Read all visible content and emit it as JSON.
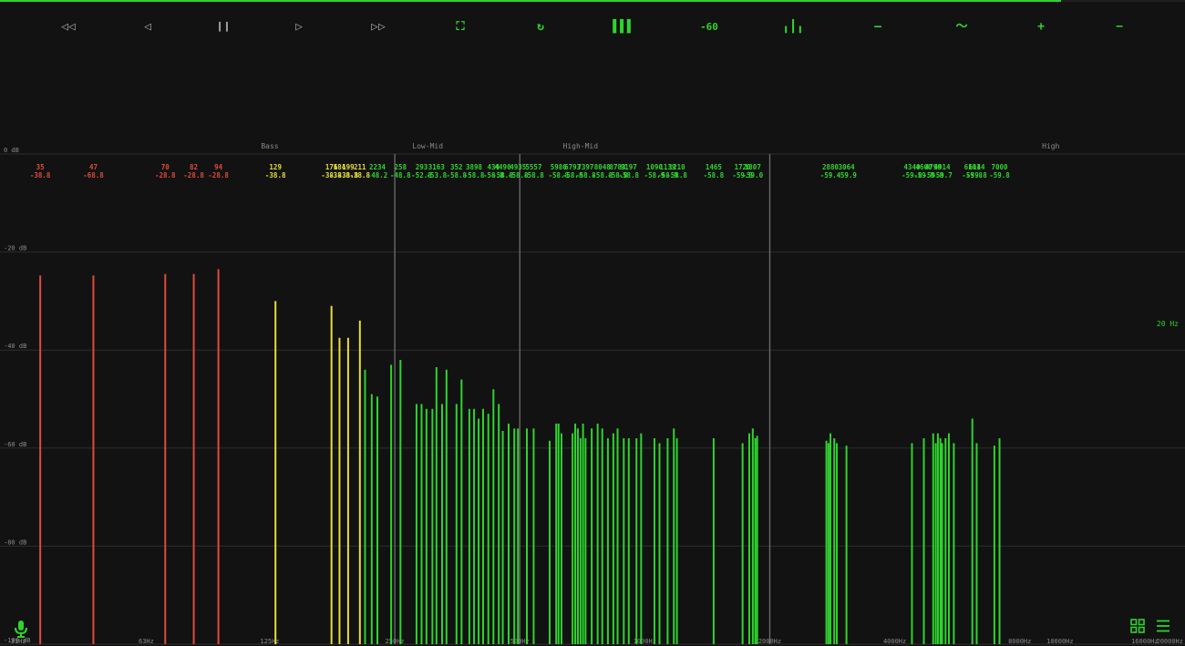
{
  "playback": {
    "progress": 0.895
  },
  "toolbar": {
    "buttons": [
      {
        "name": "rewind-button",
        "icon": "double-triangle-left",
        "glyph": "◁◁",
        "tone": "grey"
      },
      {
        "name": "previous-button",
        "icon": "triangle-left",
        "glyph": "◁",
        "tone": "grey"
      },
      {
        "name": "pause-button",
        "icon": "pause-bars",
        "glyph": "❙❙",
        "tone": "grey"
      },
      {
        "name": "next-button",
        "icon": "triangle-right",
        "glyph": "▷",
        "tone": "grey"
      },
      {
        "name": "fast-forward-button",
        "icon": "double-triangle-right",
        "glyph": "▷▷",
        "tone": "grey"
      },
      {
        "name": "fullscreen-button",
        "icon": "frame-corners",
        "glyph": "⛶",
        "tone": "green"
      },
      {
        "name": "refresh-button",
        "icon": "circular-arrow",
        "glyph": "↻",
        "tone": "green"
      },
      {
        "name": "bars-view-button",
        "icon": "many-bars",
        "glyph": "▌▌▌",
        "tone": "green"
      },
      {
        "name": "threshold-button",
        "icon": "",
        "glyph": "-60",
        "tone": "green"
      },
      {
        "name": "peaks-button",
        "icon": "three-bars",
        "glyph": "╻┃╻",
        "tone": "green"
      },
      {
        "name": "flat-line-button",
        "icon": "horizontal-line",
        "glyph": "—",
        "tone": "green"
      },
      {
        "name": "wave-button",
        "icon": "wave",
        "glyph": "〜",
        "tone": "green"
      },
      {
        "name": "zoom-in-button",
        "icon": "plus",
        "glyph": "+",
        "tone": "green"
      },
      {
        "name": "zoom-out-button",
        "icon": "minus",
        "glyph": "−",
        "tone": "green"
      }
    ]
  },
  "indicator": "20 Hz",
  "icons": {
    "mic": "microphone-icon",
    "grid": "grid-icon",
    "menu": "menu-icon"
  },
  "colors": {
    "background": "#121212",
    "red": "#e04a3a",
    "yellow": "#e8dd3a",
    "green": "#2ed42e",
    "grey_text": "#8a8a8a",
    "grid": "#2c2c2c",
    "divider": "#6e6e6e"
  },
  "chart_data": {
    "type": "bar",
    "xscale": "log",
    "xlim": [
      28,
      20000
    ],
    "ylim": [
      -100,
      0
    ],
    "grid": true,
    "y_ticks": [
      0,
      -20,
      -40,
      -60,
      -80,
      -100
    ],
    "y_tick_labels": [
      "0 dB",
      "-20 dB",
      "-40 dB",
      "-60 dB",
      "-80 dB",
      "-100 dB"
    ],
    "x_ticks": [
      31,
      63,
      125,
      250,
      500,
      1000,
      2000,
      4000,
      8000,
      10000,
      16000,
      20000
    ],
    "x_tick_labels": [
      "31Hz",
      "63Hz",
      "125Hz",
      "250Hz",
      "500Hz",
      "1000Hz",
      "2000Hz",
      "4000Hz",
      "8000Hz",
      "10000Hz",
      "16000Hz",
      "20000Hz"
    ],
    "bands": [
      {
        "label": "Bass",
        "start": 28,
        "end": 250,
        "center": 125
      },
      {
        "label": "Low-Mid",
        "start": 250,
        "end": 500,
        "center": 300
      },
      {
        "label": "High-Mid",
        "start": 500,
        "end": 2000,
        "center": 700
      },
      {
        "label": "High",
        "start": 2000,
        "end": 20000,
        "center": 9500
      }
    ],
    "band_dividers": [
      250,
      500,
      2000
    ],
    "series": [
      {
        "color": "red",
        "peaks": [
          {
            "f": 35,
            "db": -24.8,
            "label": "35",
            "value": "-38.8"
          },
          {
            "f": 47,
            "db": -24.8,
            "label": "47",
            "value": "-68.8"
          },
          {
            "f": 70,
            "db": -24.5,
            "label": "70",
            "value": "-28.8"
          },
          {
            "f": 82,
            "db": -24.5,
            "label": "82",
            "value": "-28.8"
          },
          {
            "f": 94,
            "db": -23.5,
            "label": "94",
            "value": "-28.8"
          }
        ]
      },
      {
        "color": "yellow",
        "peaks": [
          {
            "f": 129,
            "db": -30,
            "label": "129",
            "value": "-38.8"
          },
          {
            "f": 176,
            "db": -31,
            "label": "176",
            "value": "-38.8"
          },
          {
            "f": 184,
            "db": -37.5,
            "label": "184",
            "value": "-38.8"
          },
          {
            "f": 193,
            "db": -37.5,
            "label": "199",
            "value": "-38.8"
          },
          {
            "f": 206,
            "db": -34,
            "label": "211",
            "value": "-38.8"
          }
        ]
      },
      {
        "color": "green",
        "peaks": [
          {
            "f": 212,
            "db": -44,
            "label": "",
            "value": ""
          },
          {
            "f": 220,
            "db": -49,
            "label": "",
            "value": ""
          },
          {
            "f": 227,
            "db": -49.5,
            "label": "2234",
            "value": "-48.2"
          },
          {
            "f": 245,
            "db": -43,
            "label": "",
            "value": ""
          },
          {
            "f": 258,
            "db": -42,
            "label": "258",
            "value": "-48.8"
          },
          {
            "f": 282,
            "db": -51,
            "label": "",
            "value": ""
          },
          {
            "f": 290,
            "db": -51,
            "label": "293",
            "value": "-52.8"
          },
          {
            "f": 298,
            "db": -52,
            "label": "",
            "value": ""
          },
          {
            "f": 308,
            "db": -52,
            "label": "",
            "value": ""
          },
          {
            "f": 315,
            "db": -43.5,
            "label": "3163",
            "value": "-53.8"
          },
          {
            "f": 325,
            "db": -51,
            "label": "",
            "value": ""
          },
          {
            "f": 333,
            "db": -44,
            "label": "",
            "value": ""
          },
          {
            "f": 352,
            "db": -51,
            "label": "352",
            "value": "-58.8"
          },
          {
            "f": 362,
            "db": -46,
            "label": "",
            "value": ""
          },
          {
            "f": 378,
            "db": -52,
            "label": "",
            "value": ""
          },
          {
            "f": 388,
            "db": -52,
            "label": "3898",
            "value": "-58.8"
          },
          {
            "f": 398,
            "db": -54,
            "label": "",
            "value": ""
          },
          {
            "f": 408,
            "db": -52,
            "label": "",
            "value": ""
          },
          {
            "f": 420,
            "db": -53,
            "label": "",
            "value": ""
          },
          {
            "f": 432,
            "db": -48,
            "label": "434",
            "value": "-58.8"
          },
          {
            "f": 445,
            "db": -51,
            "label": "",
            "value": ""
          },
          {
            "f": 455,
            "db": -56.5,
            "label": "4490",
            "value": "-58.8"
          },
          {
            "f": 470,
            "db": -55,
            "label": "",
            "value": ""
          },
          {
            "f": 485,
            "db": -56,
            "label": "",
            "value": ""
          },
          {
            "f": 495,
            "db": -56,
            "label": "4935",
            "value": "-58.8"
          },
          {
            "f": 520,
            "db": -56,
            "label": "",
            "value": ""
          },
          {
            "f": 540,
            "db": -56,
            "label": "5557",
            "value": "-58.8"
          },
          {
            "f": 590,
            "db": -58.5,
            "label": "",
            "value": ""
          },
          {
            "f": 612,
            "db": -55,
            "label": "",
            "value": ""
          },
          {
            "f": 620,
            "db": -55,
            "label": "5980",
            "value": "-58.8"
          },
          {
            "f": 630,
            "db": -57,
            "label": "",
            "value": ""
          },
          {
            "f": 670,
            "db": -57,
            "label": "6793",
            "value": "-58.8"
          },
          {
            "f": 680,
            "db": -55,
            "label": "",
            "value": ""
          },
          {
            "f": 690,
            "db": -56,
            "label": "",
            "value": ""
          },
          {
            "f": 700,
            "db": -58,
            "label": "",
            "value": ""
          },
          {
            "f": 710,
            "db": -55,
            "label": "",
            "value": ""
          },
          {
            "f": 720,
            "db": -58,
            "label": "7397",
            "value": "-58.8"
          },
          {
            "f": 745,
            "db": -56,
            "label": "",
            "value": ""
          },
          {
            "f": 770,
            "db": -55,
            "label": "",
            "value": ""
          },
          {
            "f": 790,
            "db": -56,
            "label": "8048",
            "value": "-58.8"
          },
          {
            "f": 815,
            "db": -58,
            "label": "",
            "value": ""
          },
          {
            "f": 840,
            "db": -57,
            "label": "",
            "value": ""
          },
          {
            "f": 860,
            "db": -56,
            "label": "8783",
            "value": "-58.8"
          },
          {
            "f": 890,
            "db": -58,
            "label": "",
            "value": ""
          },
          {
            "f": 915,
            "db": -58,
            "label": "9197",
            "value": "-58.8"
          },
          {
            "f": 955,
            "db": -58,
            "label": "",
            "value": ""
          },
          {
            "f": 980,
            "db": -57,
            "label": "",
            "value": ""
          },
          {
            "f": 1055,
            "db": -58,
            "label": "1090",
            "value": "-58.9"
          },
          {
            "f": 1085,
            "db": -59,
            "label": "",
            "value": ""
          },
          {
            "f": 1135,
            "db": -58,
            "label": "1139",
            "value": "-58.9"
          },
          {
            "f": 1175,
            "db": -56,
            "label": "",
            "value": ""
          },
          {
            "f": 1195,
            "db": -58,
            "label": "1210",
            "value": "-58.8"
          },
          {
            "f": 1465,
            "db": -58,
            "label": "1465",
            "value": "-58.8"
          },
          {
            "f": 1720,
            "db": -59,
            "label": "1720",
            "value": "-59.8"
          },
          {
            "f": 1785,
            "db": -57,
            "label": "",
            "value": ""
          },
          {
            "f": 1820,
            "db": -56,
            "label": "1807",
            "value": "-59.0"
          },
          {
            "f": 1845,
            "db": -58,
            "label": "",
            "value": ""
          },
          {
            "f": 1865,
            "db": -57.5,
            "label": "",
            "value": ""
          },
          {
            "f": 2738,
            "db": -58.5,
            "label": "",
            "value": ""
          },
          {
            "f": 2770,
            "db": -59,
            "label": "",
            "value": ""
          },
          {
            "f": 2800,
            "db": -57,
            "label": "2880",
            "value": "-59.4"
          },
          {
            "f": 2860,
            "db": -58,
            "label": "",
            "value": ""
          },
          {
            "f": 2900,
            "db": -59,
            "label": "",
            "value": ""
          },
          {
            "f": 3060,
            "db": -59.5,
            "label": "3064",
            "value": "-59.9"
          },
          {
            "f": 4400,
            "db": -59,
            "label": "4340",
            "value": "-59.8"
          },
          {
            "f": 4700,
            "db": -58,
            "label": "4600",
            "value": "-59.8"
          },
          {
            "f": 4950,
            "db": -57,
            "label": "4790",
            "value": "-59.8"
          },
          {
            "f": 5020,
            "db": -59,
            "label": "",
            "value": ""
          },
          {
            "f": 5080,
            "db": -57,
            "label": "",
            "value": ""
          },
          {
            "f": 5150,
            "db": -58,
            "label": "",
            "value": ""
          },
          {
            "f": 5200,
            "db": -59,
            "label": "4914",
            "value": "-59.7"
          },
          {
            "f": 5300,
            "db": -58,
            "label": "",
            "value": ""
          },
          {
            "f": 5400,
            "db": -57,
            "label": "",
            "value": ""
          },
          {
            "f": 5550,
            "db": -59,
            "label": "",
            "value": ""
          },
          {
            "f": 6150,
            "db": -54,
            "label": "6101",
            "value": "-59.8"
          },
          {
            "f": 6300,
            "db": -59,
            "label": "6144",
            "value": "-59.8"
          },
          {
            "f": 6950,
            "db": -59.5,
            "label": "",
            "value": ""
          },
          {
            "f": 7150,
            "db": -58,
            "label": "7000",
            "value": "-59.8"
          }
        ]
      }
    ]
  }
}
